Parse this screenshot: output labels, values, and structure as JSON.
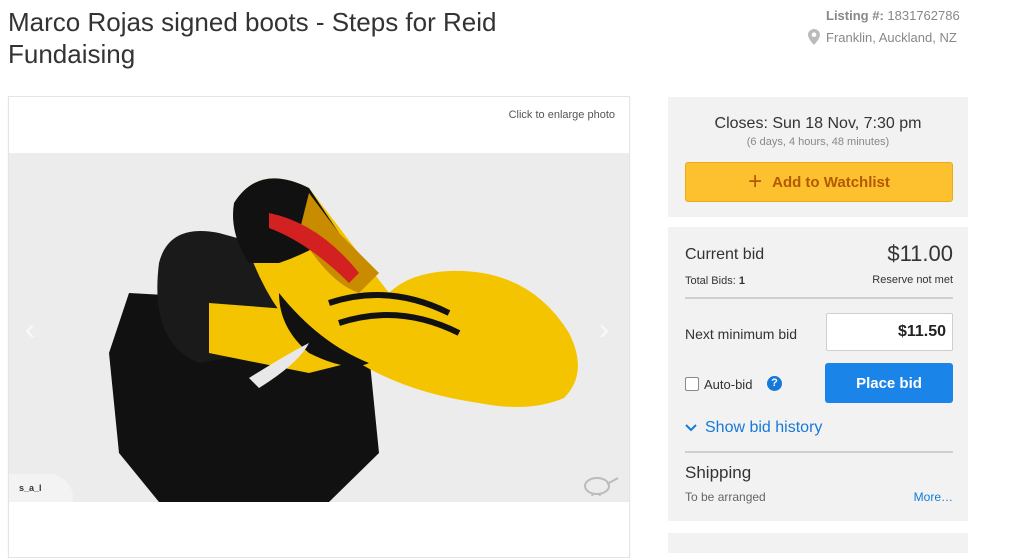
{
  "listing": {
    "title": "Marco Rojas signed boots - Steps for Reid Fundaising",
    "listing_label": "Listing #:",
    "listing_number": "1831762786",
    "location": "Franklin, Auckland, NZ"
  },
  "photo": {
    "enlarge_text": "Click to enlarge photo",
    "watermark": "s_a_l"
  },
  "closing": {
    "closes_text": "Closes: Sun 18 Nov, 7:30 pm",
    "remaining": "(6 days, 4 hours, 48 minutes)",
    "watchlist_label": "Add to Watchlist"
  },
  "bidding": {
    "current_label": "Current bid",
    "current_value": "$11.00",
    "total_bids_label": "Total Bids:",
    "total_bids": "1",
    "reserve_status": "Reserve not met",
    "next_min_label": "Next minimum bid",
    "next_min_value": "$11.50",
    "autobid_label": "Auto-bid",
    "help_glyph": "?",
    "place_bid_label": "Place bid",
    "history_label": "Show bid history"
  },
  "shipping": {
    "label": "Shipping",
    "value": "To be arranged",
    "more_label": "More…"
  },
  "colors": {
    "accent_blue": "#1a84e8",
    "watchlist_yellow": "#fdc02f",
    "boot_yellow": "#f5c400"
  },
  "icons": [
    "map-pin-icon",
    "plus-icon",
    "help-icon",
    "chevron-down-icon",
    "chevron-left-icon",
    "chevron-right-icon",
    "kiwi-logo-icon"
  ]
}
